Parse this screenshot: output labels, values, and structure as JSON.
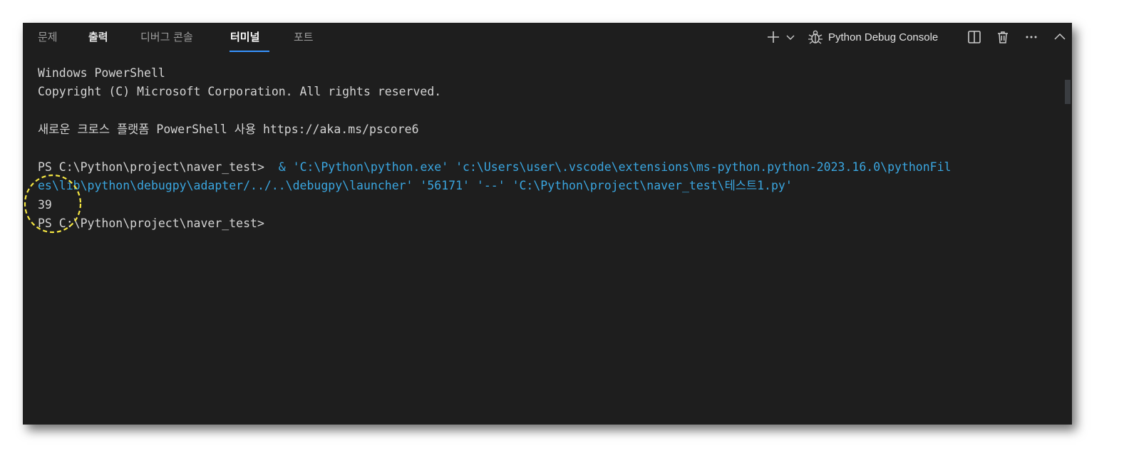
{
  "tabs": [
    {
      "label": "문제"
    },
    {
      "label": "출력"
    },
    {
      "label": "디버그 콘솔"
    },
    {
      "label": "터미널"
    },
    {
      "label": "포트"
    }
  ],
  "toolbar": {
    "terminal_name": "Python Debug Console"
  },
  "terminal": {
    "lines": [
      "Windows PowerShell",
      "Copyright (C) Microsoft Corporation. All rights reserved.",
      "",
      "새로운 크로스 플랫폼 PowerShell 사용 https://aka.ms/pscore6",
      "",
      "PS C:\\Python\\project\\naver_test> ",
      "es\\lib\\python\\debugpy\\adapter/../..\\debugpy\\launcher' '56171' '--' 'C:\\Python\\project\\naver_test\\테스트1.py'",
      "39",
      "PS C:\\Python\\project\\naver_test> "
    ],
    "command_part": " & 'C:\\Python\\python.exe' 'c:\\Users\\user\\.vscode\\extensions\\ms-python.python-2023.16.0\\pythonFil"
  },
  "colors": {
    "panel_bg": "#1e1e1e",
    "command_text": "#3aa6e0",
    "active_tab_underline": "#3794ff",
    "annotation_circle": "#f5e642"
  }
}
